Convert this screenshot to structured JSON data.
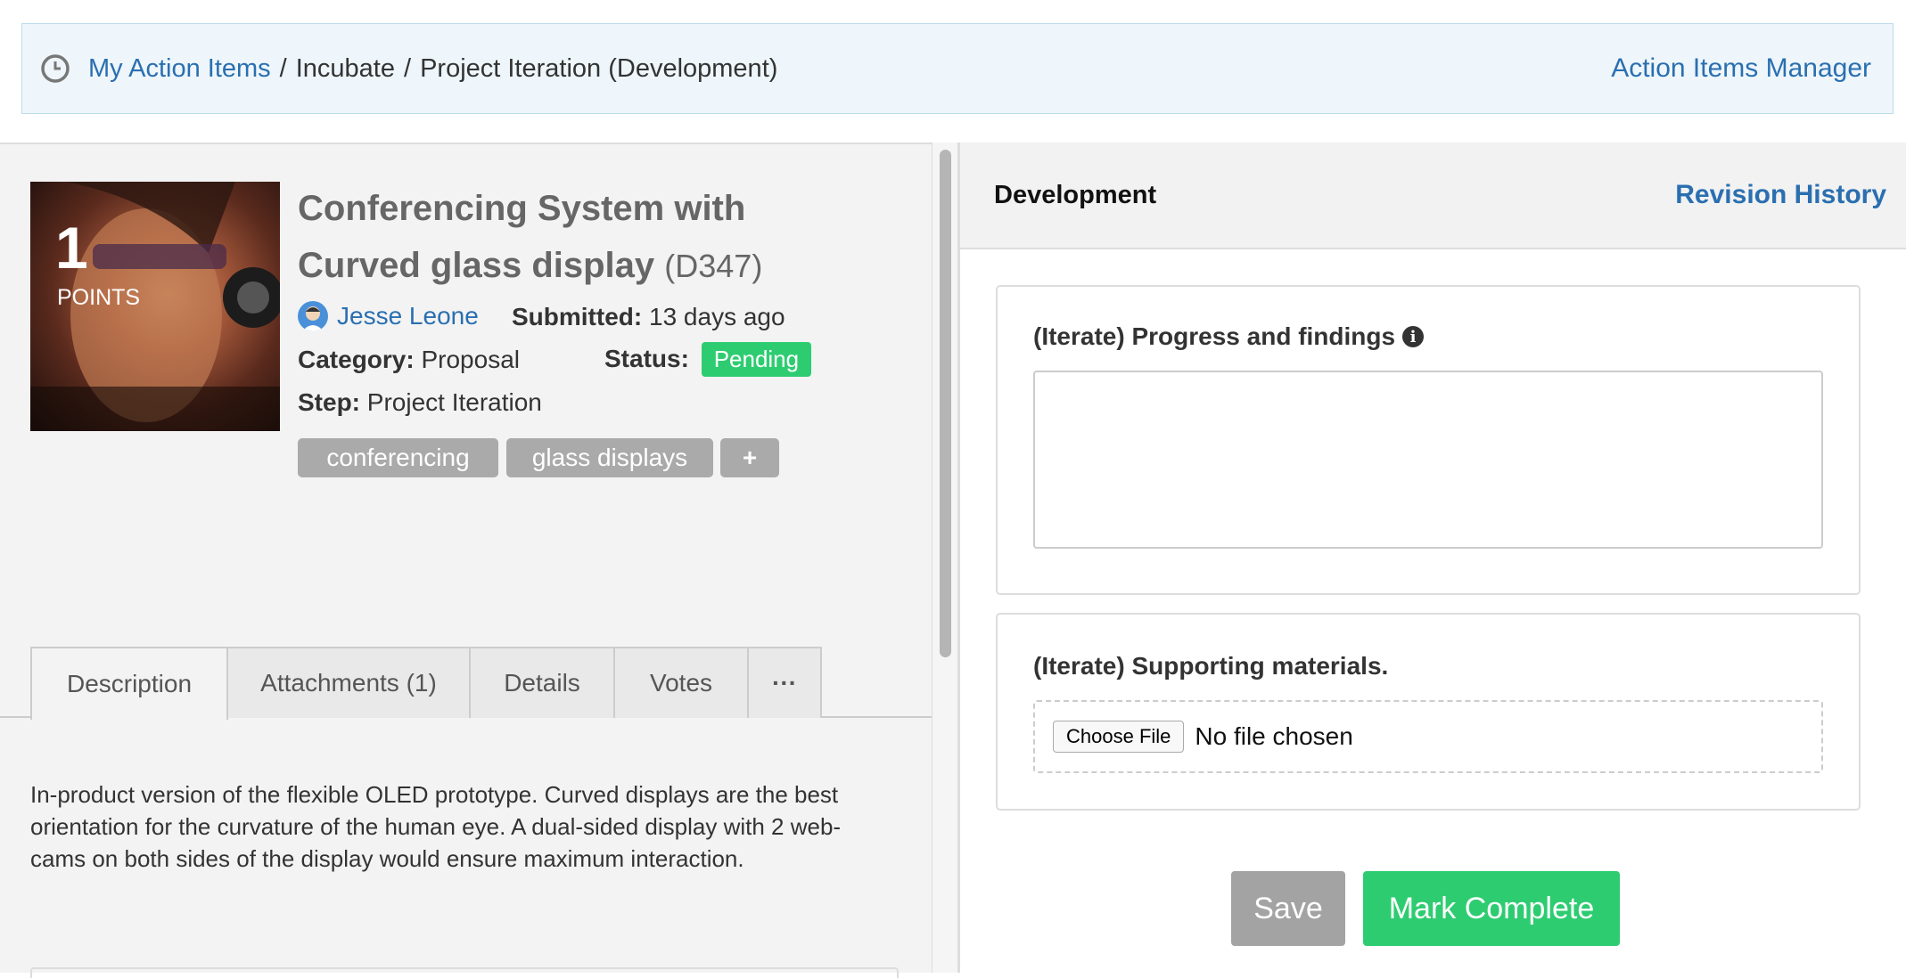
{
  "breadcrumb": {
    "root": "My Action Items",
    "sep1": "/",
    "level2": "Incubate",
    "sep2": "/",
    "current": "Project Iteration (Development)"
  },
  "header": {
    "manager_link": "Action Items Manager",
    "clock_icon": "clock-icon"
  },
  "idea": {
    "points_value": "1",
    "points_label": "POINTS",
    "title": "Conferencing System with Curved glass display",
    "code": "(D347)",
    "author": "Jesse Leone",
    "submitted_label": "Submitted:",
    "submitted_value": "13 days ago",
    "category_label": "Category:",
    "category_value": "Proposal",
    "status_label": "Status:",
    "status_value": "Pending",
    "step_label": "Step:",
    "step_value": "Project Iteration",
    "tags": [
      "conferencing",
      "glass displays"
    ],
    "add_tag": "+"
  },
  "tabs": [
    "Description",
    "Attachments (1)",
    "Details",
    "Votes",
    "···"
  ],
  "description": "In-product version of the flexible OLED prototype.  Curved displays are the best orientation for the curvature of the human eye.  A dual-sided display with 2 web-cams on both sides of the display would ensure maximum interaction.",
  "right": {
    "title": "Development",
    "revision_link": "Revision History",
    "field1_label": "(Iterate) Progress and findings",
    "field1_value": "",
    "info_icon": "i",
    "field2_label": "(Iterate) Supporting materials.",
    "choose_file": "Choose File",
    "file_status": "No file chosen",
    "save_label": "Save",
    "complete_label": "Mark Complete"
  },
  "colors": {
    "link": "#2a6fb0",
    "pending": "#2ecc71",
    "complete": "#2ecc71",
    "save": "#a3a3a3",
    "tag": "#aaaaaa"
  }
}
